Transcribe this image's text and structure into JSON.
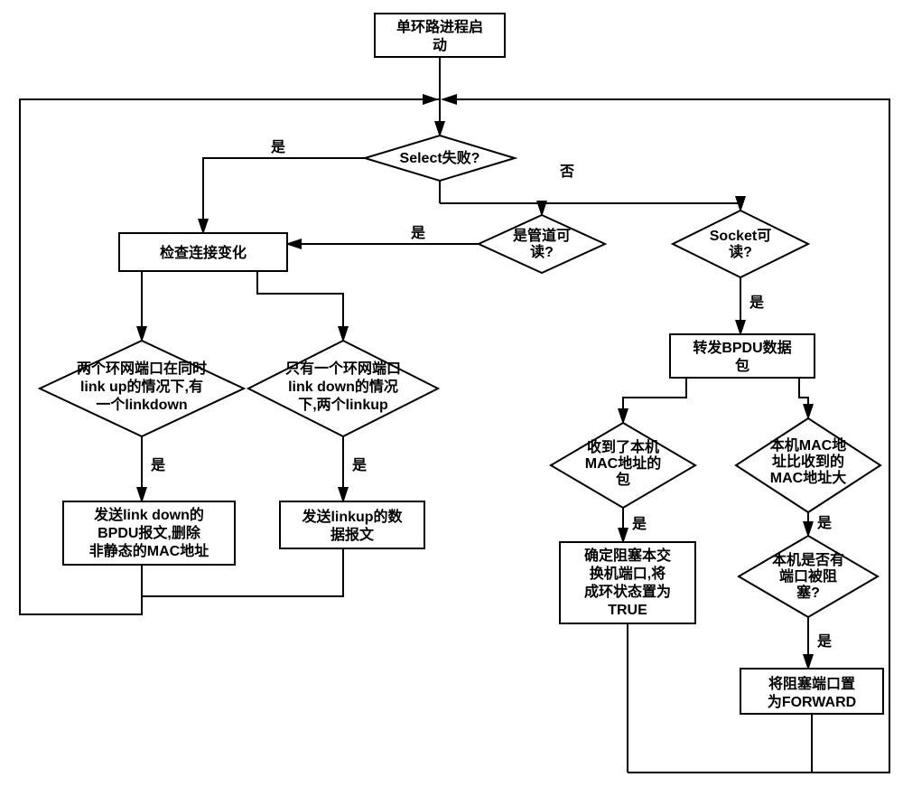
{
  "start": "单环路进程启\n动",
  "d_select": "Select失败?",
  "d_pipe": "是管道可\n读?",
  "d_socket": "Socket可\n读?",
  "box_check": "检查连接变化",
  "d_two_up": "两个环网端口在同时\nlink up的情况下,有\n一个linkdown",
  "d_one_down": "只有一个环网端口\nlink down的情况\n下,两个linkup",
  "box_send_down": "发送link down的\nBPDU报文,删除\n非静态的MAC地址",
  "box_send_up": "发送linkup的数\n据报文",
  "box_fwd_bpdu": "转发BPDU数据\n包",
  "d_rx_own": "收到了本机\nMAC地址的\n包",
  "d_mac_bigger": "本机MAC地\n址比收到的\nMAC地址大",
  "d_port_blocked": "本机是否有\n端口被阻\n塞?",
  "box_set_true": "确定阻塞本交\n换机端口,将\n成环状态置为\nTRUE",
  "box_forward": "将阻塞端口置\n为FORWARD",
  "yes": "是",
  "no": "否",
  "chart_data": {
    "type": "flowchart",
    "nodes": [
      {
        "id": "start",
        "type": "process",
        "text": "单环路进程启动"
      },
      {
        "id": "d_select",
        "type": "decision",
        "text": "Select失败?"
      },
      {
        "id": "d_pipe",
        "type": "decision",
        "text": "是管道可读?"
      },
      {
        "id": "d_socket",
        "type": "decision",
        "text": "Socket可读?"
      },
      {
        "id": "box_check",
        "type": "process",
        "text": "检查连接变化"
      },
      {
        "id": "d_two_up",
        "type": "decision",
        "text": "两个环网端口在同时link up的情况下,有一个linkdown"
      },
      {
        "id": "d_one_down",
        "type": "decision",
        "text": "只有一个环网端口link down的情况下,两个linkup"
      },
      {
        "id": "box_send_down",
        "type": "process",
        "text": "发送link down的BPDU报文,删除非静态的MAC地址"
      },
      {
        "id": "box_send_up",
        "type": "process",
        "text": "发送linkup的数据报文"
      },
      {
        "id": "box_fwd_bpdu",
        "type": "process",
        "text": "转发BPDU数据包"
      },
      {
        "id": "d_rx_own",
        "type": "decision",
        "text": "收到了本机MAC地址的包"
      },
      {
        "id": "d_mac_bigger",
        "type": "decision",
        "text": "本机MAC地址比收到的MAC地址大"
      },
      {
        "id": "d_port_blocked",
        "type": "decision",
        "text": "本机是否有端口被阻塞?"
      },
      {
        "id": "box_set_true",
        "type": "process",
        "text": "确定阻塞本交换机端口,将成环状态置为TRUE"
      },
      {
        "id": "box_forward",
        "type": "process",
        "text": "将阻塞端口置为FORWARD"
      }
    ],
    "edges": [
      {
        "from": "start",
        "to": "d_select"
      },
      {
        "from": "d_select",
        "to": "box_check",
        "label": "是"
      },
      {
        "from": "d_select",
        "to": "d_pipe",
        "label": "否"
      },
      {
        "from": "d_select",
        "to": "d_socket",
        "label": "否"
      },
      {
        "from": "d_pipe",
        "to": "box_check",
        "label": "是"
      },
      {
        "from": "d_socket",
        "to": "box_fwd_bpdu",
        "label": "是"
      },
      {
        "from": "box_check",
        "to": "d_two_up"
      },
      {
        "from": "box_check",
        "to": "d_one_down"
      },
      {
        "from": "d_two_up",
        "to": "box_send_down",
        "label": "是"
      },
      {
        "from": "d_one_down",
        "to": "box_send_up",
        "label": "是"
      },
      {
        "from": "box_send_down",
        "to": "d_select"
      },
      {
        "from": "box_send_up",
        "to": "d_select"
      },
      {
        "from": "box_fwd_bpdu",
        "to": "d_rx_own"
      },
      {
        "from": "box_fwd_bpdu",
        "to": "d_mac_bigger"
      },
      {
        "from": "d_rx_own",
        "to": "box_set_true",
        "label": "是"
      },
      {
        "from": "d_mac_bigger",
        "to": "d_port_blocked",
        "label": "是"
      },
      {
        "from": "d_port_blocked",
        "to": "box_forward",
        "label": "是"
      },
      {
        "from": "box_set_true",
        "to": "d_select"
      },
      {
        "from": "box_forward",
        "to": "d_select"
      }
    ]
  }
}
